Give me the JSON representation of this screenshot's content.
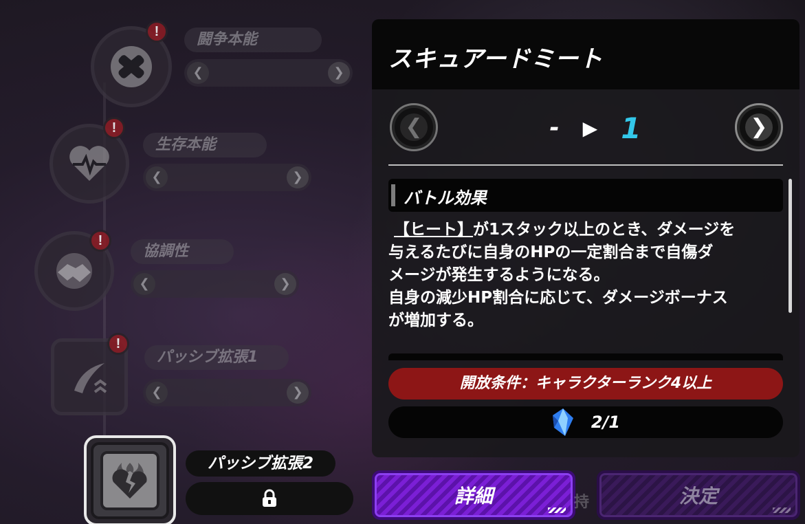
{
  "skill_tree": {
    "nodes": [
      {
        "label": "闘争本能",
        "icon": "crossed-fists-icon",
        "alert": "!"
      },
      {
        "label": "生存本能",
        "icon": "heart-pulse-icon",
        "alert": "!"
      },
      {
        "label": "協調性",
        "icon": "handshake-icon",
        "alert": "!"
      },
      {
        "label": "パッシブ拡張1",
        "icon": "slash-chevrons-icon",
        "alert": "!"
      }
    ],
    "bar_left": "❮",
    "bar_right": "❯",
    "selected": {
      "label": "パッシブ拡張2",
      "icon": "broken-heart-flame-icon",
      "lock_icon": "lock-icon"
    }
  },
  "detail_panel": {
    "title": "スキュアードミート",
    "level_current": "-",
    "level_arrow": "▶",
    "level_next": "1",
    "prev_arrow": "❮",
    "next_arrow": "❯",
    "section_title": "バトル効果",
    "desc_tag": "【ヒート】",
    "desc_line1_rest": "が1スタック以上のとき、ダメージを",
    "desc_line2": "与えるたびに自身のHPの一定割合まで自傷ダ",
    "desc_line3": "メージが発生するようになる。",
    "desc_line4": "自身の減少HP割合に応じて、ダメージボーナス",
    "desc_line5": "が増加する。",
    "unlock_condition": "開放条件：キャラクターランク4以上",
    "cost_icon": "blue-crystal-icon",
    "cost_value": "2/1"
  },
  "buttons": {
    "detail": "詳細",
    "decide": "決定"
  },
  "background_text": "持",
  "colors": {
    "accent_cyan": "#33c8ea",
    "condition_red": "#8d1616",
    "detail_purple": "#7b1fd6",
    "alert_red": "#8e1c24"
  }
}
